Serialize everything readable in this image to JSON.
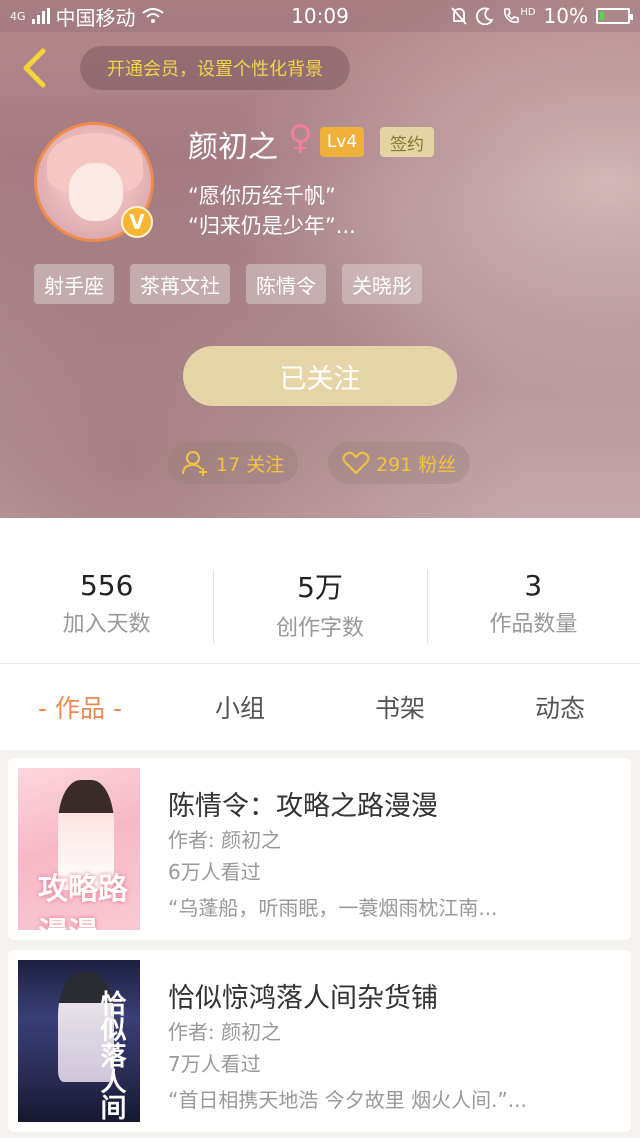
{
  "status_bar": {
    "network": "4G",
    "carrier": "中国移动",
    "time": "10:09",
    "hd_label": "HD",
    "battery": "10%",
    "icons": [
      "signal-icon",
      "wifi-icon",
      "bell-off-icon",
      "moon-icon",
      "call-icon",
      "battery-icon"
    ]
  },
  "header": {
    "vip_banner": "开通会员，设置个性化背景",
    "username": "颜初之",
    "gender_symbol": "♀",
    "level": "Lv4",
    "signed_badge": "签约",
    "verified_mark": "V",
    "motto_line1": "“愿你历经千帆”",
    "motto_line2": "“归来仍是少年”...",
    "tags": [
      "射手座",
      "茶苒文社",
      "陈情令",
      "关晓彤"
    ],
    "follow_button": "已关注",
    "following_count": "17 关注",
    "fans_count": "291 粉丝"
  },
  "stats": [
    {
      "value": "556",
      "label": "加入天数"
    },
    {
      "value": "5万",
      "label": "创作字数"
    },
    {
      "value": "3",
      "label": "作品数量"
    }
  ],
  "tabs": [
    "- 作品 -",
    "小组",
    "书架",
    "动态"
  ],
  "works": [
    {
      "title": "陈情令：攻略之路漫漫",
      "author": "作者: 颜初之",
      "views": "6万人看过",
      "excerpt": "“乌蓬船，听雨眠，一蓑烟雨枕江南...",
      "cover_text": "攻略路漫漫"
    },
    {
      "title": "恰似惊鸿落人间杂货铺",
      "author": "作者: 颜初之",
      "views": "7万人看过",
      "excerpt": "“首日相携天地浩 今夕故里 烟火人间.”...",
      "cover_text": "恰似落人间"
    }
  ],
  "colors": {
    "accent_orange": "#ef8a4f",
    "gold": "#f5c23e",
    "vip_text": "#f3d34a",
    "follow_button_bg": "#e6d5a6"
  }
}
